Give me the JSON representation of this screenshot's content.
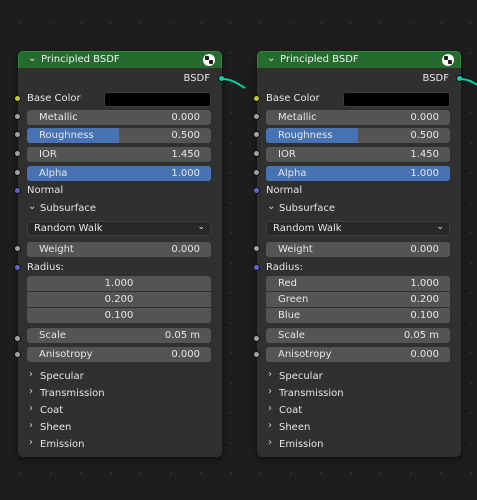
{
  "nodes": [
    {
      "title": "Principled BSDF",
      "output_label": "BSDF",
      "base_color_label": "Base Color",
      "base_color_value": "#000000",
      "metallic": {
        "label": "Metallic",
        "value": "0.000"
      },
      "roughness": {
        "label": "Roughness",
        "value": "0.500",
        "fraction": 0.5
      },
      "ior": {
        "label": "IOR",
        "value": "1.450"
      },
      "alpha": {
        "label": "Alpha",
        "value": "1.000",
        "fraction": 1.0
      },
      "normal_label": "Normal",
      "subsurface_label": "Subsurface",
      "method": "Random Walk",
      "weight": {
        "label": "Weight",
        "value": "0.000"
      },
      "radius_label": "Radius:",
      "radius": [
        {
          "label": "",
          "value": "1.000"
        },
        {
          "label": "",
          "value": "0.200"
        },
        {
          "label": "",
          "value": "0.100"
        }
      ],
      "scale": {
        "label": "Scale",
        "value": "0.05 m"
      },
      "anisotropy": {
        "label": "Anisotropy",
        "value": "0.000"
      },
      "sections": [
        "Specular",
        "Transmission",
        "Coat",
        "Sheen",
        "Emission"
      ]
    },
    {
      "title": "Principled BSDF",
      "output_label": "BSDF",
      "base_color_label": "Base Color",
      "base_color_value": "#000000",
      "metallic": {
        "label": "Metallic",
        "value": "0.000"
      },
      "roughness": {
        "label": "Roughness",
        "value": "0.500",
        "fraction": 0.5
      },
      "ior": {
        "label": "IOR",
        "value": "1.450"
      },
      "alpha": {
        "label": "Alpha",
        "value": "1.000",
        "fraction": 1.0
      },
      "normal_label": "Normal",
      "subsurface_label": "Subsurface",
      "method": "Random Walk",
      "weight": {
        "label": "Weight",
        "value": "0.000"
      },
      "radius_label": "Radius:",
      "radius": [
        {
          "label": "Red",
          "value": "1.000"
        },
        {
          "label": "Green",
          "value": "0.200"
        },
        {
          "label": "Blue",
          "value": "0.100"
        }
      ],
      "scale": {
        "label": "Scale",
        "value": "0.05 m"
      },
      "anisotropy": {
        "label": "Anisotropy",
        "value": "0.000"
      },
      "sections": [
        "Specular",
        "Transmission",
        "Coat",
        "Sheen",
        "Emission"
      ]
    }
  ],
  "colors": {
    "header": "#256b2e",
    "slider_fill": "#4772b3",
    "socket_float": "#a1a1a1",
    "socket_color": "#c7c729",
    "socket_vector": "#6363c7",
    "socket_shader": "#00d6a3"
  },
  "icons": {
    "collapse": "chevron-down-icon",
    "section": "chevron-right-icon",
    "node_preview": "material-preview-icon"
  }
}
